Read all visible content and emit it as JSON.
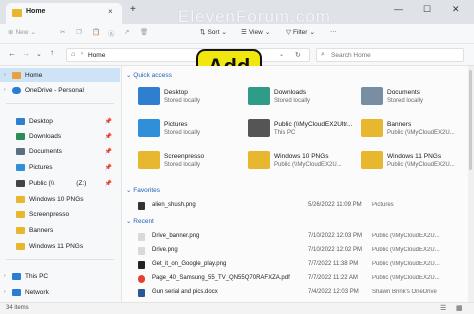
{
  "window": {
    "tab_title": "Home",
    "watermark": "ElevenForum.com",
    "new_tab": "+",
    "tab_close": "×",
    "minimize": "—",
    "maximize": "☐",
    "close": "✕"
  },
  "toolbar": {
    "new_label": "New",
    "sort_label": "Sort",
    "view_label": "View",
    "filter_label": "Filter",
    "more_label": "···"
  },
  "address": {
    "path": "Home",
    "search_placeholder": "Search Home"
  },
  "callout": {
    "text": "Add"
  },
  "nav": {
    "items": [
      {
        "label": "Home",
        "color": "#e9a23b"
      },
      {
        "label": "OneDrive - Personal",
        "color": "#2b7cd3"
      },
      {
        "label": "Desktop",
        "color": "#2f7fd1"
      },
      {
        "label": "Downloads",
        "color": "#2e8b57"
      },
      {
        "label": "Documents",
        "color": "#5c6f82"
      },
      {
        "label": "Pictures",
        "color": "#2f8fd8"
      },
      {
        "label": "Public (\\\\",
        "extra": "(Z:)",
        "color": "#444444"
      },
      {
        "label": "Windows 10 PNGs",
        "color": "#e8b730"
      },
      {
        "label": "Screenpresso",
        "color": "#e8b730"
      },
      {
        "label": "Banners",
        "color": "#e8b730"
      },
      {
        "label": "Windows 11 PNGs",
        "color": "#e8b730"
      },
      {
        "label": "This PC",
        "color": "#2b7cd3"
      },
      {
        "label": "Network",
        "color": "#2b7cd3"
      }
    ]
  },
  "quick_access": {
    "header": "Quick access",
    "items": [
      {
        "name": "Desktop",
        "sub": "Stored locally",
        "color": "#2f7fd1"
      },
      {
        "name": "Downloads",
        "sub": "Stored locally",
        "color": "#2e9c86"
      },
      {
        "name": "Documents",
        "sub": "Stored locally",
        "color": "#7a8ea3"
      },
      {
        "name": "Pictures",
        "sub": "Stored locally",
        "color": "#2f8fd8"
      },
      {
        "name": "Public (\\\\MyCloudEX2Ultr...",
        "sub": "This PC",
        "color": "#555555"
      },
      {
        "name": "Banners",
        "sub": "Public (\\\\MyCloudEX2U...",
        "color": "#e8b730"
      },
      {
        "name": "Screenpresso",
        "sub": "Stored locally",
        "color": "#e8b730"
      },
      {
        "name": "Windows 10 PNGs",
        "sub": "Public (\\\\MyCloudEX2U...",
        "color": "#e8b730"
      },
      {
        "name": "Windows 11 PNGs",
        "sub": "Public (\\\\MyCloudEX2U...",
        "color": "#e8b730"
      }
    ]
  },
  "favorites": {
    "header": "Favorites",
    "rows": [
      {
        "name": "alien_shush.png",
        "date": "5/26/2022 11:09 PM",
        "location": "Pictures"
      }
    ]
  },
  "recent": {
    "header": "Recent",
    "rows": [
      {
        "name": "Drive_banner.png",
        "date": "7/10/2022 12:03 PM",
        "location": "Public (\\\\MyCloudEX2U..."
      },
      {
        "name": "Drive.png",
        "date": "7/10/2022 12:02 PM",
        "location": "Public (\\\\MyCloudEX2U..."
      },
      {
        "name": "Get_it_on_Google_play.png",
        "date": "7/7/2022 11:38 PM",
        "location": "Public (\\\\MyCloudEX2U..."
      },
      {
        "name": "Page_40_Samsung_55_TV_QN55Q70RAFXZA.pdf",
        "date": "7/7/2022 11:22 AM",
        "location": "Public (\\\\MyCloudEX2U..."
      },
      {
        "name": "Gun serial and pics.docx",
        "date": "7/4/2022 12:03 PM",
        "location": "Shawn Brink's OneDrive"
      }
    ]
  },
  "status": {
    "count": "34 items"
  }
}
